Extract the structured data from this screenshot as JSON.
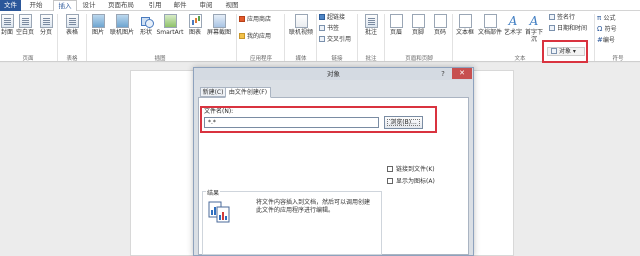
{
  "tabs": [
    "文件",
    "开始",
    "插入",
    "设计",
    "页面布局",
    "引用",
    "邮件",
    "审阅",
    "视图"
  ],
  "ribbon": {
    "groups": {
      "pages": "页面",
      "tables": "表格",
      "illustrations": "插图",
      "apps": "应用程序",
      "media": "媒体",
      "links": "链接",
      "comments": "批注",
      "header_footer": "页眉和页脚",
      "text": "文本",
      "symbols": "符号"
    },
    "buttons": {
      "cover": "封面",
      "blank": "空白页",
      "break": "分页",
      "table": "表格",
      "picture": "图片",
      "online_picture": "联机图片",
      "shapes": "形状",
      "smartart": "SmartArt",
      "chart": "图表",
      "screenshot": "屏幕截图",
      "app_store": "应用商店",
      "my_apps": "我的应用",
      "online_video": "联机视频",
      "hyperlink": "超链接",
      "bookmark": "书签",
      "crossref": "交叉引用",
      "comment": "批注",
      "header": "页眉",
      "footer": "页脚",
      "page_number": "页码",
      "textbox": "文本框",
      "quickparts": "文档部件",
      "wordart": "艺术字",
      "dropcap": "首字下沉",
      "signature": "签名行",
      "datetime": "日期和时间",
      "object": "对象",
      "equation": "公式",
      "symbol": "符号",
      "number": "编号"
    }
  },
  "dialog": {
    "title": "对象",
    "help": "?",
    "close": "✕",
    "tabs": [
      "新建(C)",
      "由文件创建(F)"
    ],
    "filename_label": "文件名(N):",
    "filename_value": "*.*",
    "browse_label": "浏览(B)...",
    "link_checkbox": "链接到文件(K)",
    "icon_checkbox": "显示为图标(A)",
    "result_label": "结果",
    "result_text": "将文件内容插入到文档，然后可以调用创建此文件的应用程序进行编辑。"
  }
}
